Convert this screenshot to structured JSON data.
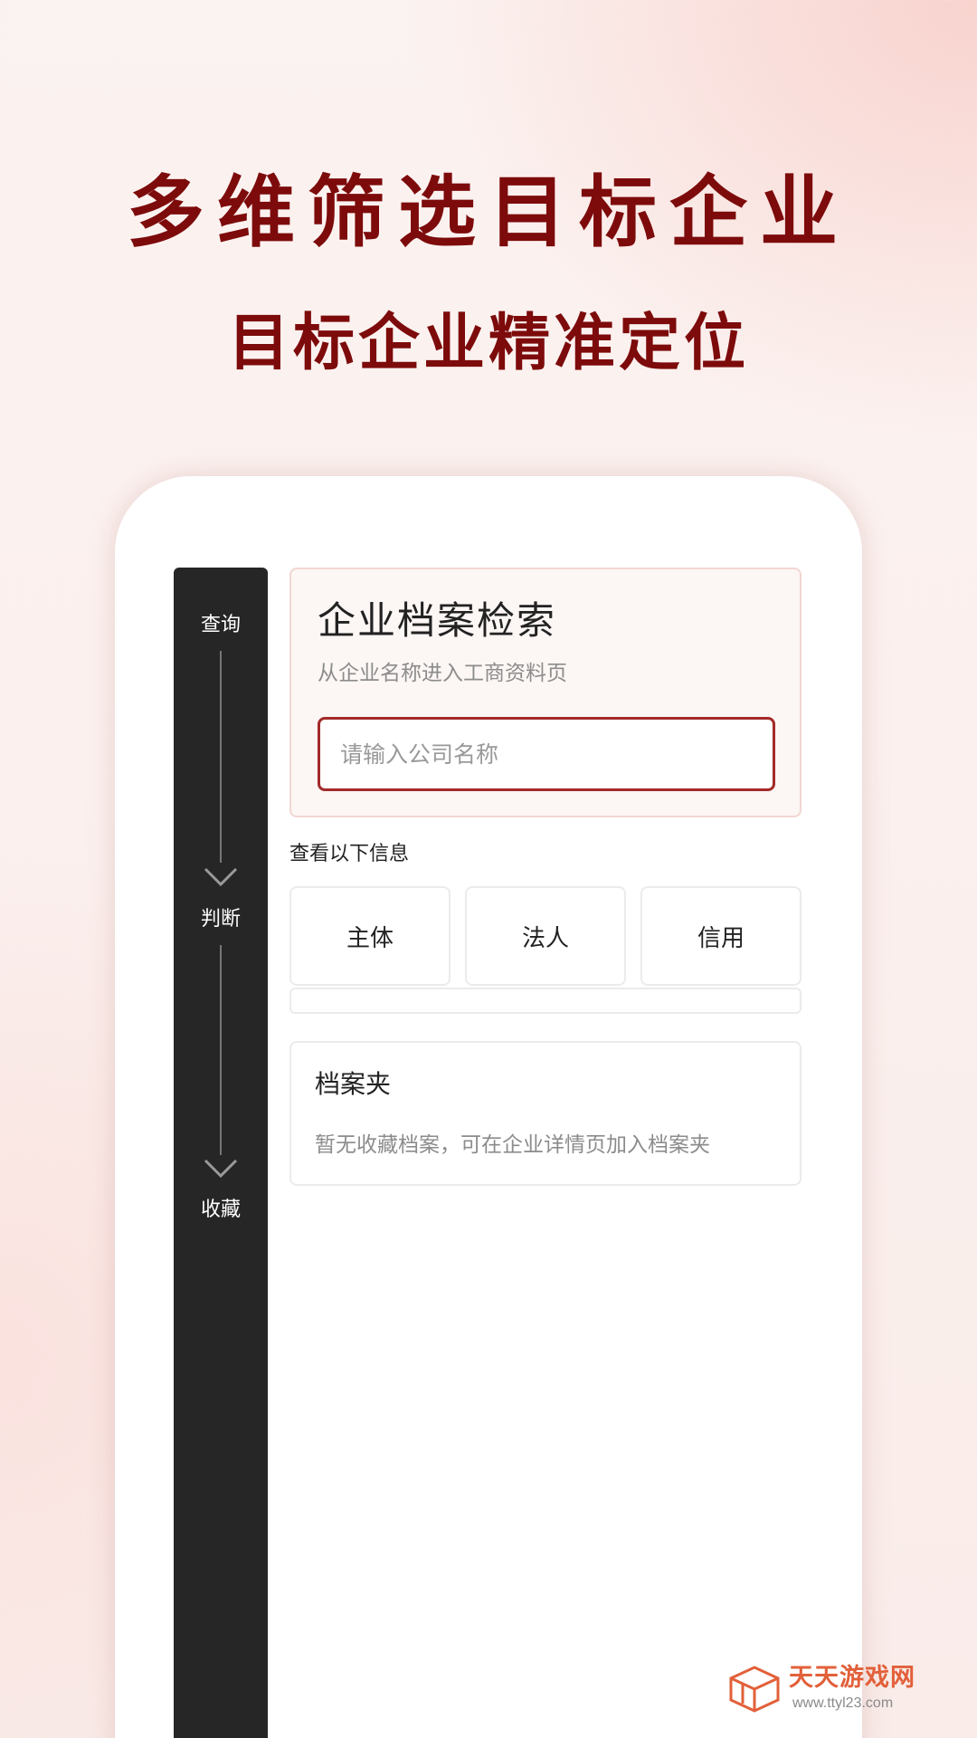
{
  "headline": {
    "title": "多维筛选目标企业",
    "subtitle": "目标企业精准定位"
  },
  "sidebar": {
    "steps": [
      {
        "label": "查询"
      },
      {
        "label": "判断"
      },
      {
        "label": "收藏"
      }
    ]
  },
  "search_card": {
    "title": "企业档案检索",
    "subtitle": "从企业名称进入工商资料页",
    "input_placeholder": "请输入公司名称",
    "input_value": ""
  },
  "info": {
    "label": "查看以下信息",
    "buttons": [
      {
        "label": "主体"
      },
      {
        "label": "法人"
      },
      {
        "label": "信用"
      }
    ]
  },
  "folder": {
    "title": "档案夹",
    "empty_text": "暂无收藏档案，可在企业详情页加入档案夹"
  },
  "watermark": {
    "name": "天天游戏网",
    "url": "www.ttyl23.com"
  },
  "colors": {
    "headline": "#7d0b0b",
    "sidebar": "#262626",
    "input_border": "#a32a2a",
    "watermark": "#e2603a"
  }
}
